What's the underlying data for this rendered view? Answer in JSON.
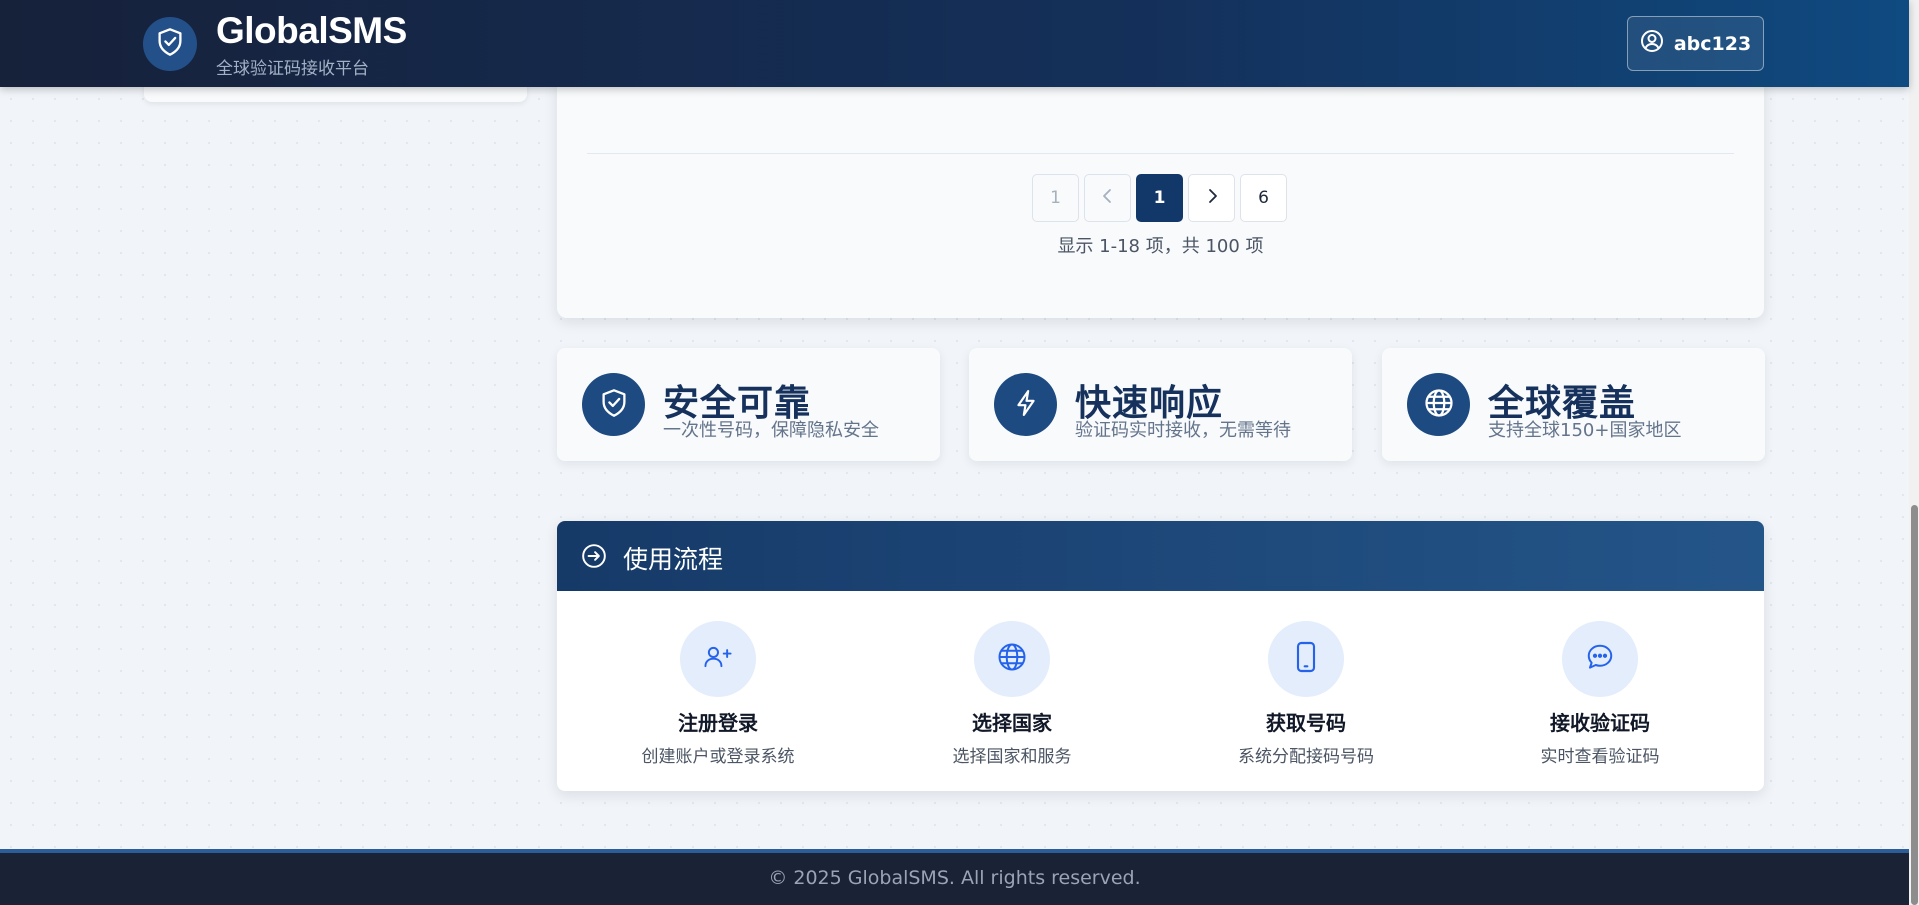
{
  "header": {
    "brand_name": "GlobalSMS",
    "brand_subtitle": "全球验证码接收平台",
    "username": "abc123",
    "logo_icon": "shield-check-icon",
    "user_icon": "user-circle-icon"
  },
  "pagination": {
    "first_label": "1",
    "current_label": "1",
    "last_label": "6",
    "summary": "显示 1-18 项，共 100 项",
    "current_page": 1,
    "total_pages": 6
  },
  "features": [
    {
      "title": "安全可靠",
      "desc": "一次性号码，保障隐私安全",
      "icon": "shield-check-icon"
    },
    {
      "title": "快速响应",
      "desc": "验证码实时接收，无需等待",
      "icon": "lightning-icon"
    },
    {
      "title": "全球覆盖",
      "desc": "支持全球150+国家地区",
      "icon": "globe-icon"
    }
  ],
  "process": {
    "title": "使用流程",
    "icon": "arrow-right-circle-icon",
    "steps": [
      {
        "title": "注册登录",
        "desc": "创建账户或登录系统",
        "icon": "user-plus-icon"
      },
      {
        "title": "选择国家",
        "desc": "选择国家和服务",
        "icon": "globe-icon"
      },
      {
        "title": "获取号码",
        "desc": "系统分配接码号码",
        "icon": "phone-icon"
      },
      {
        "title": "接收验证码",
        "desc": "实时查看验证码",
        "icon": "chat-dots-icon"
      }
    ]
  },
  "footer": {
    "copyright": "© 2025 GlobalSMS. All rights reserved."
  },
  "colors": {
    "brand_dark": "#12386a",
    "header_gradient_start": "#16213a",
    "header_gradient_end": "#0f4a80",
    "step_icon_bg": "#e3edfb",
    "step_icon_color": "#2563eb"
  }
}
